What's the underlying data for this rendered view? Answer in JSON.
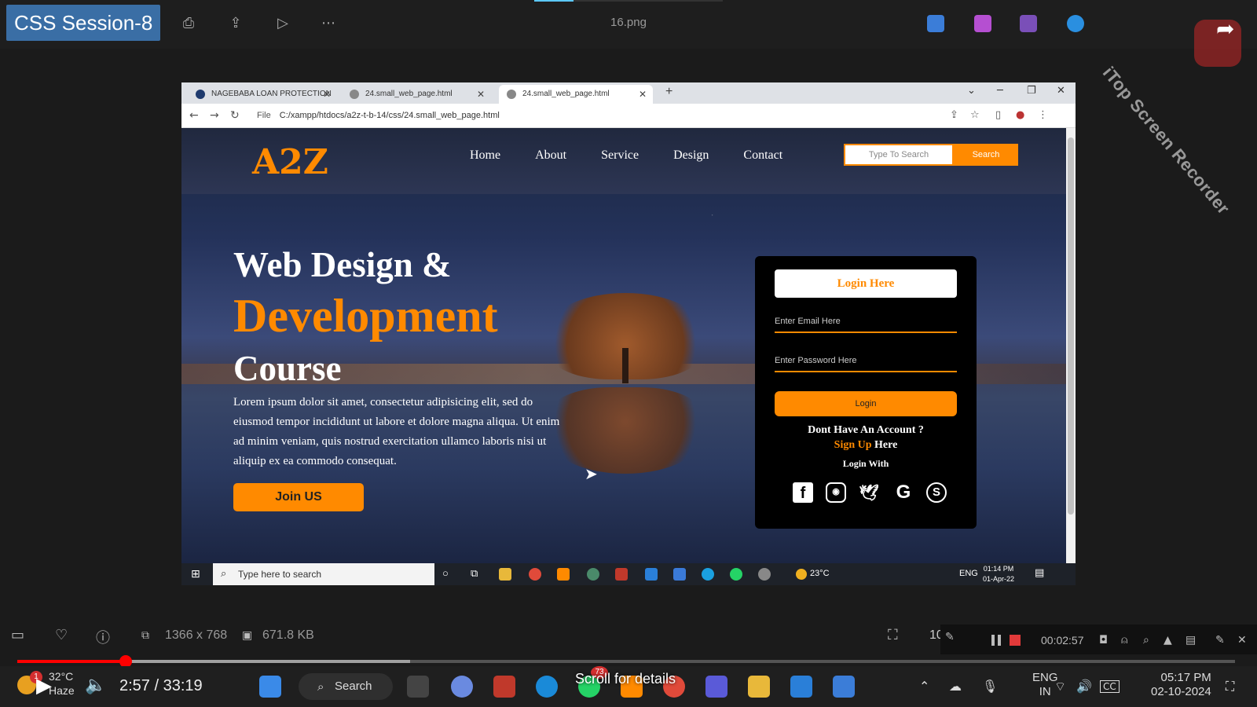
{
  "viewer": {
    "session_label": "CSS Session-8",
    "filename": "16.png",
    "watermark": "iTop Screen Recorder",
    "meta_dimensions": "1366 x 768",
    "meta_filesize": "671.8 KB",
    "zoom_partial": "10"
  },
  "browser": {
    "tabs": [
      {
        "label": "NAGEBABA LOAN PROTECTION"
      },
      {
        "label": "24.small_web_page.html"
      },
      {
        "label": "24.small_web_page.html"
      }
    ],
    "url_prefix": "File",
    "url": "C:/xampp/htdocs/a2z-t-b-14/css/24.small_web_page.html"
  },
  "site": {
    "logo": "A2Z",
    "nav": [
      "Home",
      "About",
      "Service",
      "Design",
      "Contact"
    ],
    "search_placeholder": "Type To Search",
    "search_button": "Search",
    "hero_line1": "Web Design &",
    "hero_line2": "Development",
    "hero_line3": "Course",
    "hero_paragraph": "Lorem ipsum dolor sit amet, consectetur adipisicing elit, sed do eiusmod tempor incididunt ut labore et dolore magna aliqua. Ut enim ad minim veniam, quis nostrud exercitation ullamco laboris nisi ut aliquip ex ea commodo consequat.",
    "join_button": "Join US"
  },
  "login": {
    "title": "Login Here",
    "email_placeholder": "Enter Email Here",
    "password_placeholder": "Enter Password Here",
    "button": "Login",
    "no_account": "Dont Have An Account ?",
    "signup_link": "Sign Up",
    "signup_suffix": "Here",
    "login_with": "Login With",
    "social_icons": [
      "facebook-icon",
      "instagram-icon",
      "twitter-icon",
      "google-icon",
      "skype-icon"
    ]
  },
  "inner_taskbar": {
    "search_placeholder": "Type here to search",
    "temperature": "23°C",
    "language": "ENG",
    "time": "01:14 PM",
    "date": "01-Apr-22"
  },
  "recorder": {
    "elapsed": "00:02:57"
  },
  "player": {
    "time": "2:57 / 33:19",
    "progress_fraction": 0.089,
    "scroll_hint": "Scroll for details"
  },
  "host_taskbar": {
    "weather_temp": "32°C",
    "weather_text": "Haze",
    "search_label": "Search",
    "lang_1": "ENG",
    "lang_2": "IN",
    "clock_time": "05:17 PM",
    "clock_date": "02-10-2024",
    "badge_count": "1",
    "whatsapp_badge": "73"
  },
  "colors": {
    "accent": "#ff8a00",
    "brand_session": "#3a6ea5",
    "player_red": "#ff0000"
  }
}
